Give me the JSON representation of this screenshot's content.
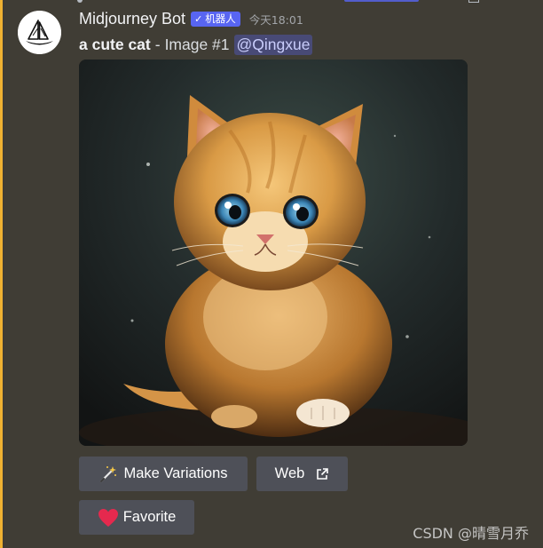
{
  "message": {
    "author": "Midjourney Bot",
    "bot_tag": {
      "icon": "checkmark-icon",
      "label": "机器人",
      "color": "#5865f2"
    },
    "timestamp": "今天18:01",
    "prompt": "a cute cat",
    "separator": "-",
    "image_label": "Image #1",
    "mention": "@Qingxue",
    "attachment": {
      "alt": "Illustrated fluffy orange kitten with big blue eyes sitting on a dark background",
      "icon": "image"
    }
  },
  "buttons": {
    "make_variations": {
      "label": "Make Variations",
      "icon": "magic-wand-icon"
    },
    "web": {
      "label": "Web",
      "icon": "external-link-icon"
    },
    "favorite": {
      "label": "Favorite",
      "icon": "heart-icon",
      "icon_color": "#e5294e"
    }
  },
  "watermark": "CSDN @晴雪月乔",
  "colors": {
    "background": "#403d35",
    "accent_bar": "#f0b232",
    "button": "#4e5058",
    "mention_bg": "#5865f2"
  }
}
